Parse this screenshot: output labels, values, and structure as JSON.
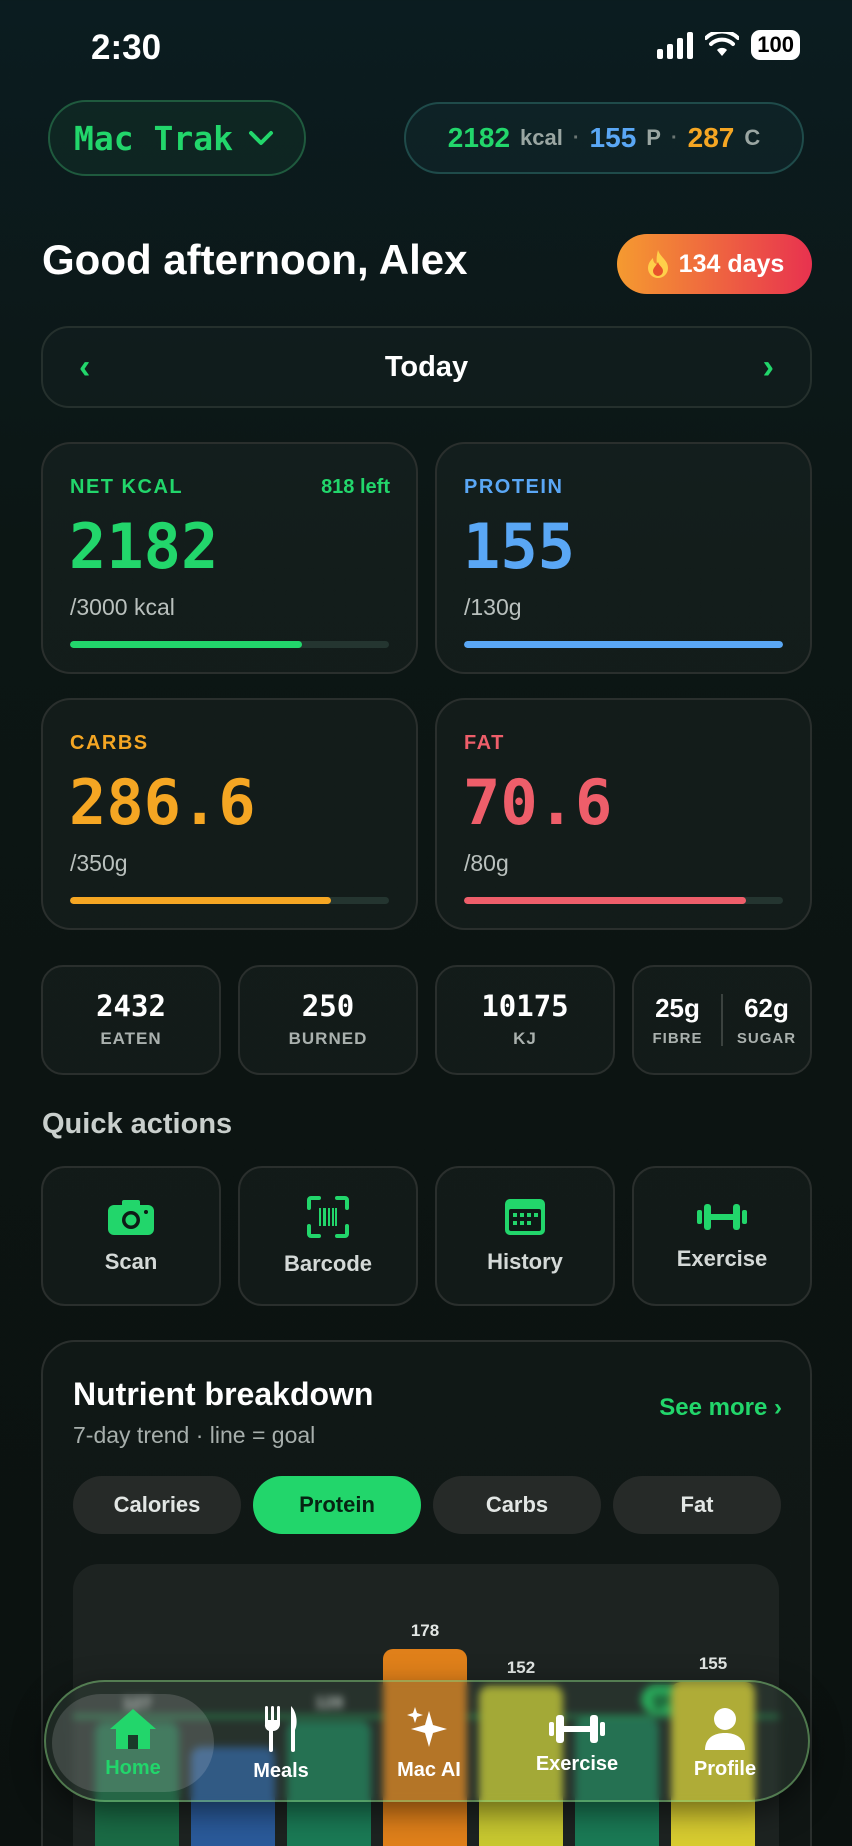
{
  "status": {
    "time": "2:30",
    "battery": "100"
  },
  "header": {
    "app_name": "Mac Trak",
    "summary": {
      "kcal": "2182",
      "kcal_unit": "kcal",
      "protein": "155",
      "protein_unit": "P",
      "carbs": "287",
      "carbs_unit": "C",
      "separator": "·"
    }
  },
  "greeting": "Good afternoon, Alex",
  "streak": {
    "icon": "fire-icon",
    "label": "134 days"
  },
  "date_nav": {
    "label": "Today"
  },
  "macros": {
    "net_kcal": {
      "title": "NET KCAL",
      "left": "818 left",
      "value": "2182",
      "goal": "/3000 kcal",
      "progress": 0.727,
      "color": "#22d66b"
    },
    "protein": {
      "title": "PROTEIN",
      "value": "155",
      "goal": "/130g",
      "progress": 1.0,
      "color": "#5aa7f5"
    },
    "carbs": {
      "title": "CARBS",
      "value": "286.6",
      "goal": "/350g",
      "progress": 0.819,
      "color": "#f5a623"
    },
    "fat": {
      "title": "FAT",
      "value": "70.6",
      "goal": "/80g",
      "progress": 0.883,
      "color": "#ee5e6a"
    }
  },
  "stats": {
    "eaten": {
      "value": "2432",
      "label": "EATEN"
    },
    "burned": {
      "value": "250",
      "label": "BURNED"
    },
    "kj": {
      "value": "10175",
      "label": "KJ"
    },
    "fibre": {
      "value": "25g",
      "label": "FIBRE"
    },
    "sugar": {
      "value": "62g",
      "label": "SUGAR"
    }
  },
  "quick_actions": {
    "title": "Quick actions",
    "items": [
      {
        "label": "Scan",
        "icon": "camera-icon"
      },
      {
        "label": "Barcode",
        "icon": "barcode-icon"
      },
      {
        "label": "History",
        "icon": "calendar-icon"
      },
      {
        "label": "Exercise",
        "icon": "dumbbell-icon"
      }
    ]
  },
  "breakdown": {
    "title": "Nutrient breakdown",
    "subtitle": "7-day trend · line = goal",
    "see_more": "See more",
    "tabs": [
      "Calories",
      "Protein",
      "Carbs",
      "Fat"
    ],
    "active_tab": "Protein",
    "goal_label": "goal 130"
  },
  "chart_data": {
    "type": "bar",
    "categories": [
      "",
      "",
      "",
      "",
      "",
      "",
      "",
      ""
    ],
    "values": [
      127,
      110,
      128,
      178,
      152,
      130,
      155
    ],
    "value_labels": [
      "127",
      "",
      "128",
      "178",
      "152",
      "",
      "155"
    ],
    "goal": 130,
    "ylim": [
      0,
      220
    ],
    "bar_colors": [
      "#1a6b45",
      "#2a5a9a",
      "#1a7a55",
      "#e0801a",
      "#c8c830",
      "#1a7a55",
      "#d8cc30"
    ]
  },
  "bottom_nav": {
    "items": [
      {
        "label": "Home",
        "icon": "home-icon",
        "active": true
      },
      {
        "label": "Meals",
        "icon": "fork-knife-icon",
        "active": false
      },
      {
        "label": "Mac AI",
        "icon": "sparkles-icon",
        "active": false
      },
      {
        "label": "Exercise",
        "icon": "dumbbell-icon",
        "active": false
      },
      {
        "label": "Profile",
        "icon": "person-icon",
        "active": false
      }
    ]
  },
  "colors": {
    "accent": "#22d66b",
    "protein": "#5aa7f5",
    "carbs": "#f5a623",
    "fat": "#ee5e6a"
  }
}
